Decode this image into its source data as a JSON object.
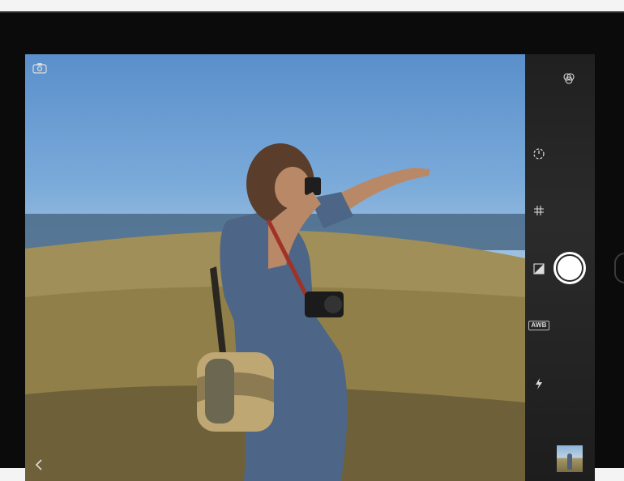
{
  "app": {
    "name": "Camera"
  },
  "controls": {
    "awb_label": "AWB",
    "icons": [
      "filters-icon",
      "timer-icon",
      "grid-icon",
      "exposure-icon",
      "awb-icon",
      "flash-icon",
      "shutter-button",
      "last-photo-thumbnail"
    ]
  },
  "viewfinder": {
    "overlay_icons": [
      "switch-camera-icon",
      "back-chevron-icon"
    ]
  },
  "colors": {
    "control_bar": "#232323",
    "device_bezel": "#0b0b0b",
    "shutter": "#ffffff"
  }
}
